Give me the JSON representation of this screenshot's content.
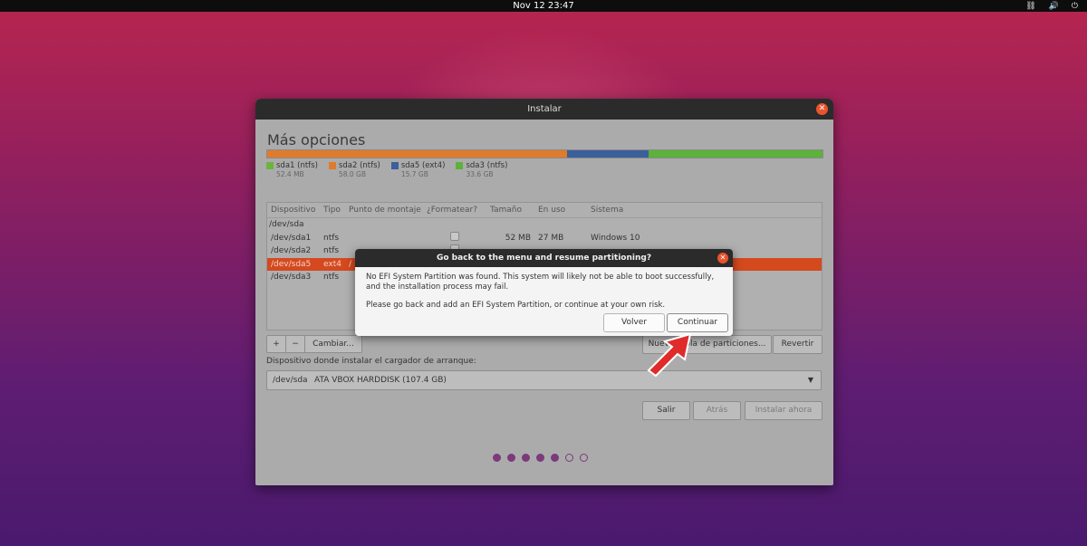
{
  "topbar": {
    "datetime": "Nov 12  23:47",
    "tray_icons": [
      "network-icon",
      "volume-icon",
      "power-icon"
    ]
  },
  "window": {
    "title": "Instalar",
    "heading": "Más opciones",
    "partition_bar": [
      {
        "name": "sda1",
        "color": "#6db33f",
        "fraction": 0.0005
      },
      {
        "name": "sda2",
        "color": "#e07b2c",
        "fraction": 0.54
      },
      {
        "name": "sda5",
        "color": "#3b5f9b",
        "fraction": 0.146
      },
      {
        "name": "sda3",
        "color": "#5cb23a",
        "fraction": 0.313
      }
    ],
    "legend": [
      {
        "label": "sda1 (ntfs)",
        "size": "52.4 MB",
        "color": "#6db33f"
      },
      {
        "label": "sda2 (ntfs)",
        "size": "58.0 GB",
        "color": "#e07b2c"
      },
      {
        "label": "sda5 (ext4)",
        "size": "15.7 GB",
        "color": "#3b5f9b"
      },
      {
        "label": "sda3 (ntfs)",
        "size": "33.6 GB",
        "color": "#5cb23a"
      }
    ],
    "table": {
      "headers": [
        "Dispositivo",
        "Tipo",
        "Punto de montaje",
        "¿Formatear?",
        "Tamaño",
        "En uso",
        "Sistema"
      ],
      "disk": "/dev/sda",
      "rows": [
        {
          "device": "/dev/sda1",
          "type": "ntfs",
          "mount": "",
          "size": "52 MB",
          "used": "27 MB",
          "system": "Windows 10"
        },
        {
          "device": "/dev/sda2",
          "type": "ntfs",
          "mount": "",
          "size": "",
          "used": "",
          "system": ""
        },
        {
          "device": "/dev/sda5",
          "type": "ext4",
          "mount": "/",
          "size": "",
          "used": "",
          "system": ""
        },
        {
          "device": "/dev/sda3",
          "type": "ntfs",
          "mount": "",
          "size": "",
          "used": "",
          "system": ""
        }
      ]
    },
    "toolbar": {
      "add": "+",
      "remove": "−",
      "change": "Cambiar..."
    },
    "new_table_button": "Nueva tabla de particiones...",
    "revert_button": "Revertir",
    "boot_label": "Dispositivo donde instalar el cargador de arranque:",
    "boot_device": "/dev/sda",
    "boot_disk": "ATA VBOX HARDDISK (107.4 GB)",
    "buttons": {
      "quit": "Salir",
      "back": "Atrás",
      "install": "Instalar ahora"
    },
    "progress": {
      "total": 7,
      "completed": 5
    }
  },
  "dialog": {
    "title": "Go back to the menu and resume partitioning?",
    "message1": "No EFI System Partition was found. This system will likely not be able to boot successfully, and the installation process may fail.",
    "message2": "Please go back and add an EFI System Partition, or continue at your own risk.",
    "back_button": "Volver",
    "continue_button": "Continuar"
  }
}
